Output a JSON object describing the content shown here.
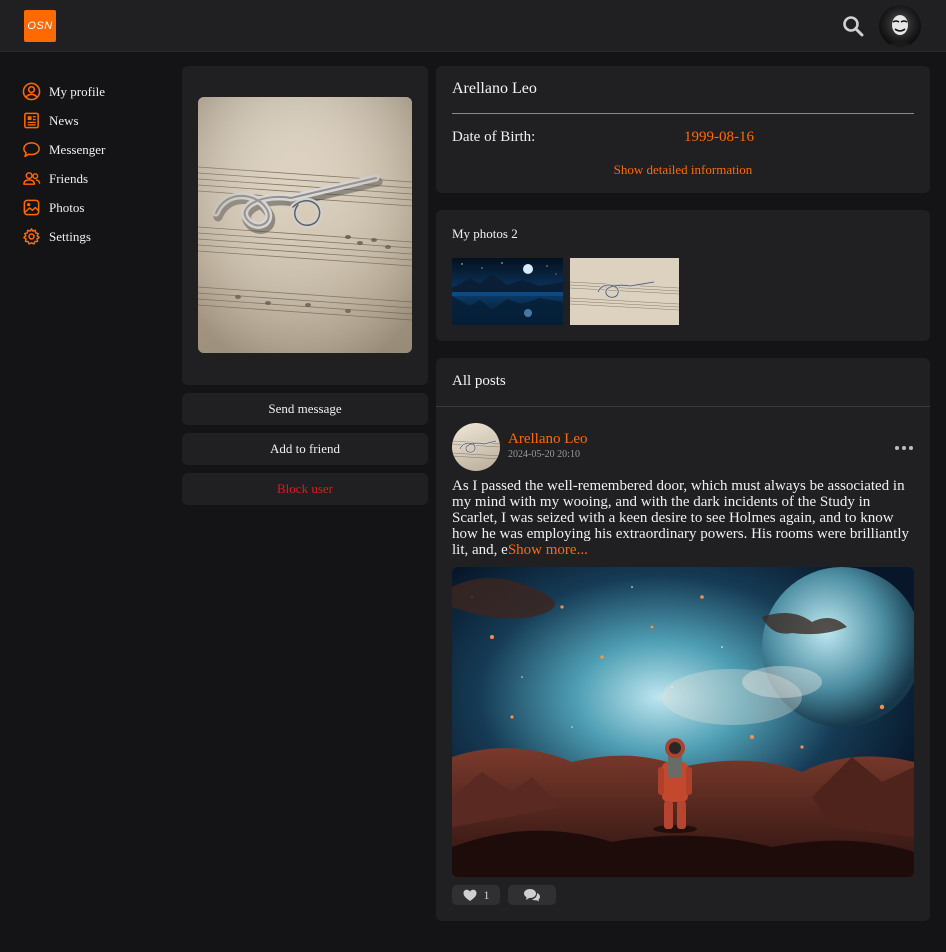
{
  "header": {
    "logo_text": "OSN",
    "search_icon": "search-icon",
    "avatar_icon": "user-avatar"
  },
  "sidebar": {
    "items": [
      {
        "label": "My profile",
        "icon": "user-circle-icon"
      },
      {
        "label": "News",
        "icon": "newspaper-icon"
      },
      {
        "label": "Messenger",
        "icon": "chat-bubble-icon"
      },
      {
        "label": "Friends",
        "icon": "friends-icon"
      },
      {
        "label": "Photos",
        "icon": "image-icon"
      },
      {
        "label": "Settings",
        "icon": "gear-icon"
      }
    ]
  },
  "profile": {
    "actions": {
      "send_message": "Send message",
      "add_friend": "Add to friend",
      "block_user": "Block user"
    }
  },
  "info": {
    "name": "Arellano Leo",
    "dob_label": "Date of Birth:",
    "dob_value": "1999-08-16",
    "show_detail": "Show detailed information"
  },
  "photos": {
    "title": "My photos 2"
  },
  "posts": {
    "title": "All posts",
    "items": [
      {
        "author": "Arellano Leo",
        "time": "2024-05-20 20:10",
        "text": "As I passed the well-remembered door, which must always be associated in my mind with my wooing, and with the dark incidents of the Study in Scarlet, I was seized with a keen desire to see Holmes again, and to know how he was employing his extraordinary powers. His rooms were brilliantly lit, and, e",
        "show_more": "Show more...",
        "likes": "1"
      }
    ]
  },
  "colors": {
    "accent": "#ff6a00",
    "danger": "#e01a1a",
    "background": "#141416",
    "card": "#202022"
  }
}
